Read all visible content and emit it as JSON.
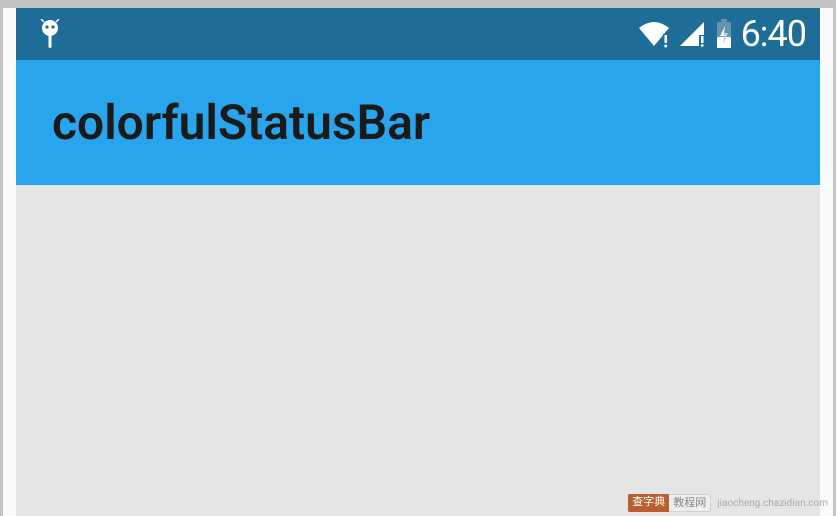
{
  "statusBar": {
    "time": "6:40"
  },
  "appBar": {
    "title": "colorfulStatusBar"
  },
  "watermark": {
    "badge_left": "查字典",
    "badge_right": "教程网",
    "url": "jiaocheng.chazidian.com"
  },
  "colors": {
    "statusBarBg": "#1e6d99",
    "appBarBg": "#29a5ed",
    "contentBg": "#e5e5e5"
  }
}
